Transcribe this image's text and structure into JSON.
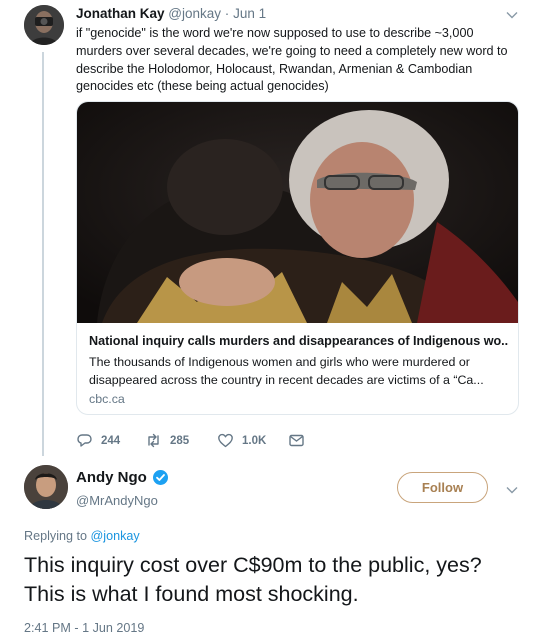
{
  "tweet1": {
    "author_name": "Jonathan Kay",
    "author_handle": "@jonkay",
    "separator": "·",
    "date": "Jun 1",
    "text": "if \"genocide\" is the word we're now supposed to use to describe ~3,000 murders over several decades, we're going to need a completely new word to describe the Holodomor, Holocaust, Rwandan, Armenian & Cambodian genocides etc (these being actual genocides)",
    "card": {
      "title": "National inquiry calls murders and disappearances of Indigenous wo...",
      "description": "The thousands of Indigenous women and girls who were murdered or disappeared across the country in recent decades are victims of a “Ca...",
      "domain": "cbc.ca"
    },
    "actions": {
      "replies": "244",
      "retweets": "285",
      "likes": "1.0K"
    }
  },
  "tweet2": {
    "author_name": "Andy Ngo",
    "author_handle": "@MrAndyNgo",
    "follow_label": "Follow",
    "replying_prefix": "Replying to",
    "replying_to": "@jonkay",
    "text": "This inquiry cost over C$90m to the public, yes? This is what I found most shocking.",
    "timestamp": "2:41 PM - 1 Jun 2019"
  },
  "colors": {
    "text": "#14171a",
    "secondary": "#657786",
    "link": "#1b95e0",
    "follow_accent": "#a88052",
    "verified": "#1da1f2",
    "border": "#e1e8ed"
  },
  "icons": [
    "reply-icon",
    "retweet-icon",
    "like-icon",
    "dm-icon",
    "verified-icon",
    "chevron-down-icon"
  ]
}
